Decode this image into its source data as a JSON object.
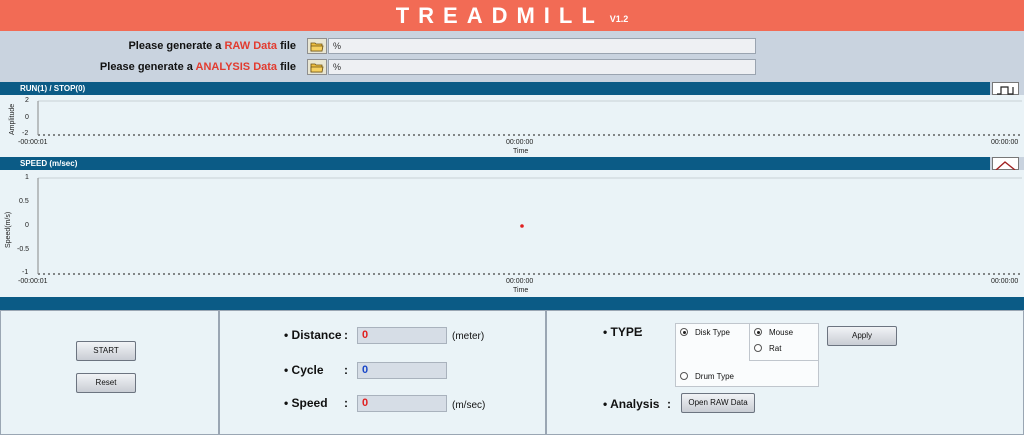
{
  "app": {
    "title": "TREADMILL",
    "version": "V1.2"
  },
  "files": {
    "raw": {
      "prefix": "Please generate a ",
      "highlight": "RAW Data",
      "suffix": " file",
      "path_prefix": "%",
      "value": ""
    },
    "analysis": {
      "prefix": "Please generate a ",
      "highlight": "ANALYSIS Data",
      "suffix": " file",
      "path_prefix": "%",
      "value": ""
    }
  },
  "run_chart": {
    "band_label": "RUN(1) / STOP(0)",
    "icon": "square-wave-icon",
    "chart_data": {
      "type": "line",
      "title": "",
      "xlabel": "Time",
      "ylabel": "Amplitude",
      "ylim": [
        -2,
        2
      ],
      "y_ticks": [
        "2",
        "0",
        "-2"
      ],
      "x_ticks": [
        "-00:00:01",
        "00:00:00",
        "00:00:00"
      ],
      "series": []
    }
  },
  "speed_chart": {
    "band_label": "SPEED (m/sec)",
    "icon": "triangle-wave-icon",
    "chart_data": {
      "type": "scatter",
      "title": "",
      "xlabel": "Time",
      "ylabel": "Speed(m/s)",
      "ylim": [
        -1,
        1
      ],
      "y_ticks": [
        "1",
        "0.5",
        "0",
        "-0.5",
        "-1"
      ],
      "x_ticks": [
        "-00:00:01",
        "00:00:00",
        "00:00:00"
      ],
      "series": [
        {
          "points": [
            {
              "x": "00:00:00",
              "y": 0
            }
          ],
          "color": "#e02020"
        }
      ]
    }
  },
  "controls": {
    "start_label": "START",
    "reset_label": "Reset"
  },
  "readouts": {
    "distance": {
      "label": "Distance",
      "value": "0",
      "unit": "(meter)",
      "color": "#e02020"
    },
    "cycle": {
      "label": "Cycle",
      "value": "0",
      "color": "#1a47c8"
    },
    "speed": {
      "label": "Speed",
      "value": "0",
      "unit": "(m/sec)",
      "color": "#e02020"
    }
  },
  "type_panel": {
    "type_label": "TYPE",
    "disk_type": "Disk Type",
    "drum_type": "Drum Type",
    "mouse": "Mouse",
    "rat": "Rat",
    "selected_type": "Disk Type",
    "selected_animal": "Mouse",
    "apply_label": "Apply",
    "analysis_label": "Analysis",
    "open_raw_label": "Open RAW Data"
  }
}
